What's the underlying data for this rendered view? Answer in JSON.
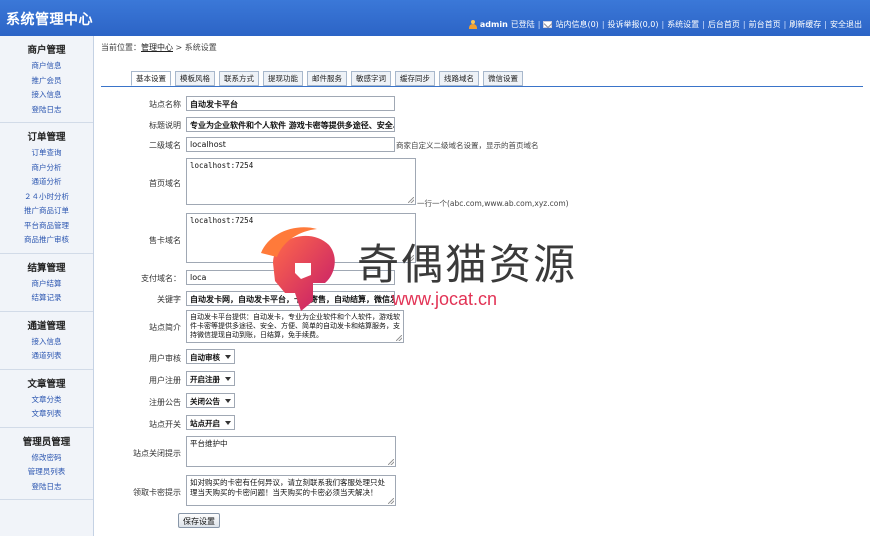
{
  "header": {
    "title": "系统管理中心",
    "user": "admin",
    "logged_in": "已登陆",
    "messages": "站内信息(0)",
    "complaints": "投诉举报(0,0)",
    "settings": "系统设置",
    "backend_home": "后台首页",
    "frontend_home": "前台首页",
    "refresh_cache": "刷新缓存",
    "logout": "安全退出",
    "separator": "|"
  },
  "sidebar": [
    {
      "title": "商户管理",
      "items": [
        "商户信息",
        "推广会员",
        "接入信息",
        "登陆日志"
      ]
    },
    {
      "title": "订单管理",
      "items": [
        "订单查询",
        "商户分析",
        "通道分析",
        "２４小时分析",
        "推广商品订单",
        "平台商品管理",
        "商品推广审核"
      ]
    },
    {
      "title": "结算管理",
      "items": [
        "商户结算",
        "结算记录"
      ]
    },
    {
      "title": "通道管理",
      "items": [
        "接入信息",
        "通道列表"
      ]
    },
    {
      "title": "文章管理",
      "items": [
        "文章分类",
        "文章列表"
      ]
    },
    {
      "title": "管理员管理",
      "items": [
        "修改密码",
        "管理员列表",
        "登陆日志"
      ]
    }
  ],
  "breadcrumb": {
    "prefix": "当前位置：",
    "home": "管理中心",
    "sep": " > ",
    "current": "系统设置"
  },
  "tabs": [
    "基本设置",
    "模板风格",
    "联系方式",
    "提现功能",
    "邮件服务",
    "敏感字词",
    "缓存同步",
    "线路域名",
    "微信设置"
  ],
  "form": {
    "site_name": {
      "label": "站点名称",
      "value": "自动发卡平台"
    },
    "title_desc": {
      "label": "标题说明",
      "value": "专业为企业软件和个人软件 游戏卡密等提供多途径、安全、方"
    },
    "second_domain": {
      "label": "二级域名",
      "value": "localhost",
      "hint": "商家自定义二级域名设置，显示的首页域名"
    },
    "home_domain": {
      "label": "首页域名",
      "value": "localhost:7254",
      "hint": "一行一个(abc.com,www.ab.com,xyz.com)"
    },
    "card_domain": {
      "label": "售卡域名",
      "value": "localhost:7254"
    },
    "pay_domain": {
      "label": "支付域名：",
      "value": "loca"
    },
    "keywords": {
      "label": "关键字",
      "value": "自动发卡网，自动发卡平台，卡密寄售，自动结算，微信发卡"
    },
    "intro": {
      "label": "站点简介",
      "value": "自动发卡平台提供：自动发卡，专业为企业软件和个人软件，游戏软件卡密等提供多途径、安全、方便、简单的自动发卡和结算服务，支持微信提现自动到账，日结算，免手续费。"
    },
    "user_review": {
      "label": "用户审核",
      "value": "自动审核"
    },
    "user_register": {
      "label": "用户注册",
      "value": "开启注册"
    },
    "register_notice": {
      "label": "注册公告",
      "value": "关闭公告"
    },
    "site_switch": {
      "label": "站点开关",
      "value": "站点开启"
    },
    "close_notice": {
      "label": "站点关闭提示",
      "value": "平台维护中"
    },
    "pickup_notice": {
      "label": "领取卡密提示",
      "value": "如对购买的卡密有任何异议，请立刻联系我们客服处理只处理当天购买的卡密问题！当天购买的卡密必须当天解决！"
    },
    "save": "保存设置"
  },
  "watermark": {
    "text": "奇偶猫资源",
    "url": "www.jocat.cn"
  },
  "colors": {
    "header": "#2c64c6",
    "link": "#2a55b0",
    "watermark_red": "#e23355"
  }
}
